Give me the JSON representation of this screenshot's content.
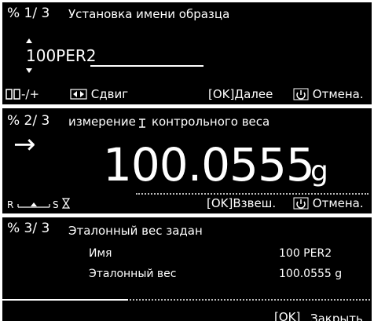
{
  "screens": [
    {
      "step": "% 1/ 3",
      "title": "Установка имени образца",
      "input_value": "100PER2",
      "softkeys": [
        "-/+",
        "Сдвиг",
        "[OK]Далее",
        "Отмена."
      ]
    },
    {
      "step": "% 2/ 3",
      "title": "измерение",
      "title2": "контрольного веса",
      "arrow": "→",
      "value": "100.0555",
      "unit": "g",
      "status_left": "R",
      "status_s": "S",
      "softkeys": [
        "[OK]Взвеш.",
        "Отмена."
      ]
    },
    {
      "step": "% 3/ 3",
      "title": "Эталонный вес задан",
      "rows": [
        {
          "label": "Имя",
          "value": "100 PER2"
        },
        {
          "label": "Эталонный вес",
          "value": "100.0555 g"
        }
      ],
      "softkeys": [
        "[OK]",
        "Закрыть"
      ]
    }
  ],
  "icons": [
    "up-down-arrow-icon",
    "stability-icon",
    "power-icon"
  ]
}
